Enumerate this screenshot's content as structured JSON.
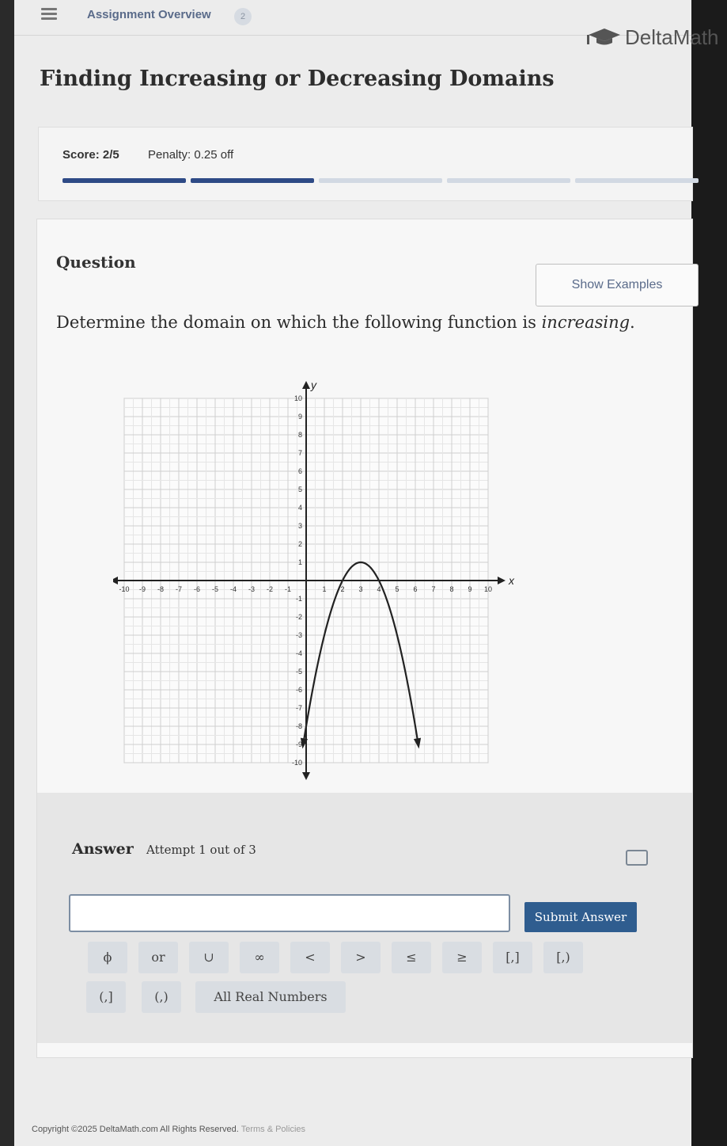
{
  "header": {
    "overview_label": "Assignment Overview",
    "badge": "2",
    "brand": "DeltaMath"
  },
  "title": "Finding Increasing or Decreasing Domains",
  "scorecard": {
    "score": "Score: 2/5",
    "penalty": "Penalty: 0.25 off",
    "progress_done": 2,
    "progress_total": 5
  },
  "question": {
    "label": "Question",
    "show_examples": "Show Examples",
    "prompt_before": "Determine the domain on which the following function is ",
    "prompt_emphasis": "increasing",
    "prompt_after": "."
  },
  "graph": {
    "x_axis_label": "x",
    "y_axis_label": "y",
    "x_ticks": [
      "-10",
      "-9",
      "-8",
      "-7",
      "-6",
      "-5",
      "-4",
      "-3",
      "-2",
      "-1",
      "1",
      "2",
      "3",
      "4",
      "5",
      "6",
      "7",
      "8",
      "9",
      "10"
    ],
    "y_ticks": [
      "10",
      "9",
      "8",
      "7",
      "6",
      "5",
      "4",
      "3",
      "2",
      "1",
      "-1",
      "-2",
      "-3",
      "-4",
      "-5",
      "-6",
      "-7",
      "-8",
      "-9",
      "-10"
    ],
    "xlim": [
      -10,
      10
    ],
    "ylim": [
      -10,
      10
    ],
    "vertex": [
      3,
      1
    ],
    "leading_coefficient": -1,
    "curve_color": "#222222",
    "grid": true
  },
  "answer": {
    "label": "Answer",
    "attempt": "Attempt 1 out of 3",
    "input_value": "",
    "submit": "Submit Answer",
    "keys_row1": [
      "ϕ",
      "or",
      "∪",
      "∞",
      "<",
      ">",
      "≤",
      "≥",
      "[,]",
      "[,)"
    ],
    "keys_row2": [
      "(,]",
      "(,)",
      "All Real Numbers"
    ]
  },
  "footer": {
    "text": "Copyright ©2025 DeltaMath.com All Rights Reserved.",
    "links": "Terms & Policies"
  },
  "colors": {
    "accent": "#2f5d8f",
    "progress_done": "#2e4a86",
    "progress_todo": "#d2d9e3"
  }
}
